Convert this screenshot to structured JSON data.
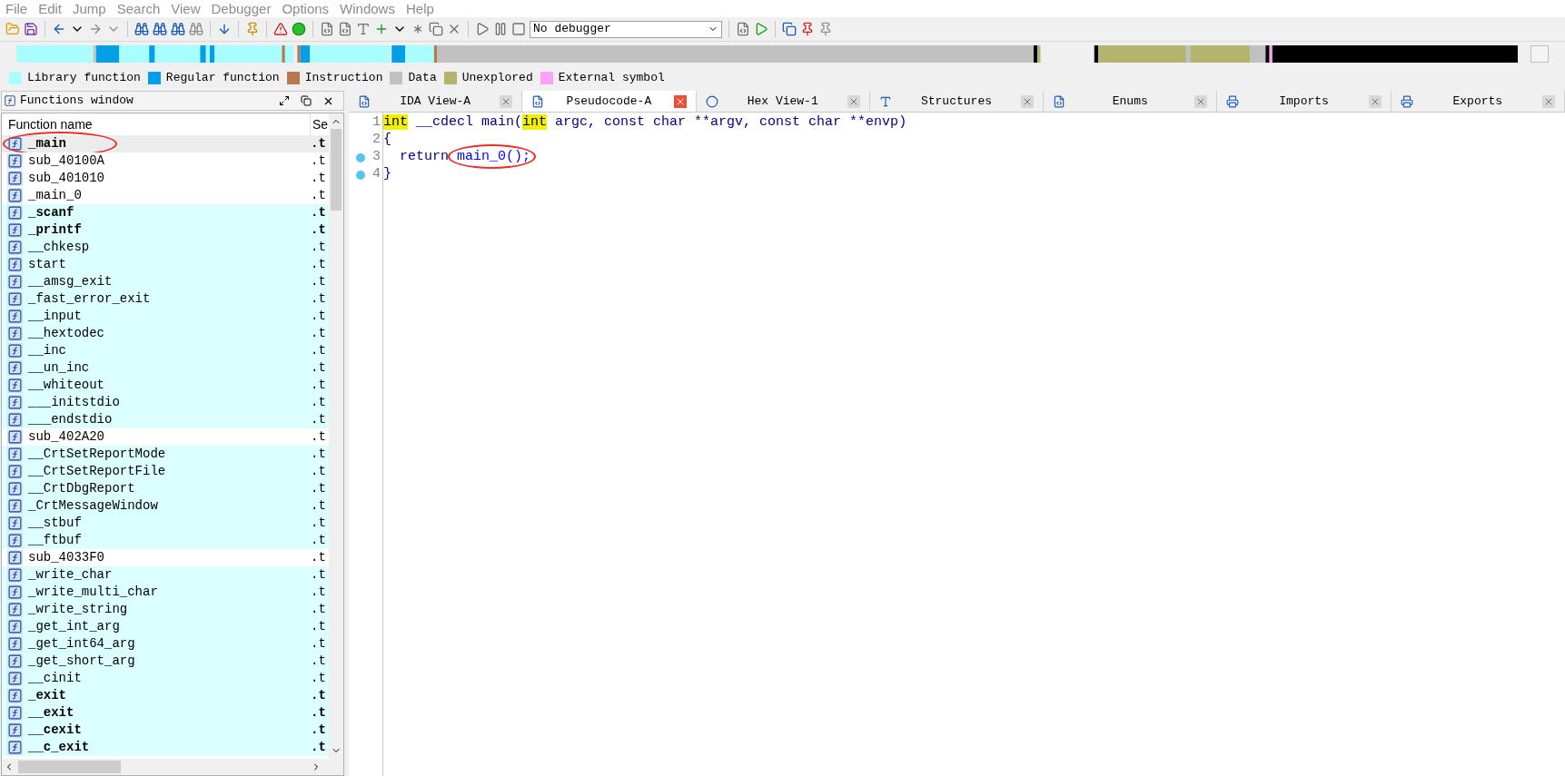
{
  "menu": [
    "File",
    "Edit",
    "Jump",
    "Search",
    "View",
    "Debugger",
    "Options",
    "Windows",
    "Help"
  ],
  "toolbar": {
    "debugger_select": "No debugger"
  },
  "legend": [
    {
      "label": "Library function",
      "color": "#a9ffff"
    },
    {
      "label": "Regular function",
      "color": "#00a0e8"
    },
    {
      "label": "Instruction",
      "color": "#b87850"
    },
    {
      "label": "Data",
      "color": "#c0c0c0"
    },
    {
      "label": "Unexplored",
      "color": "#b4b46c"
    },
    {
      "label": "External symbol",
      "color": "#ffa0f8"
    }
  ],
  "functions_window": {
    "title": "Functions window",
    "columns": [
      "Function name",
      "Se"
    ],
    "rows": [
      {
        "name": "_main",
        "segment": ".t",
        "bold": true,
        "kind": "regular",
        "selected": true,
        "circled": true
      },
      {
        "name": "sub_40100A",
        "segment": ".t",
        "bold": false,
        "kind": "regular",
        "selected": false,
        "circled": false
      },
      {
        "name": "sub_401010",
        "segment": ".t",
        "bold": false,
        "kind": "regular",
        "selected": false,
        "circled": false
      },
      {
        "name": "_main_0",
        "segment": ".t",
        "bold": false,
        "kind": "regular",
        "selected": false,
        "circled": false
      },
      {
        "name": "_scanf",
        "segment": ".t",
        "bold": true,
        "kind": "library",
        "selected": false,
        "circled": false
      },
      {
        "name": "_printf",
        "segment": ".t",
        "bold": true,
        "kind": "library",
        "selected": false,
        "circled": false
      },
      {
        "name": "__chkesp",
        "segment": ".t",
        "bold": false,
        "kind": "library",
        "selected": false,
        "circled": false
      },
      {
        "name": "start",
        "segment": ".t",
        "bold": false,
        "kind": "library",
        "selected": false,
        "circled": false
      },
      {
        "name": "__amsg_exit",
        "segment": ".t",
        "bold": false,
        "kind": "library",
        "selected": false,
        "circled": false
      },
      {
        "name": "_fast_error_exit",
        "segment": ".t",
        "bold": false,
        "kind": "library",
        "selected": false,
        "circled": false
      },
      {
        "name": "__input",
        "segment": ".t",
        "bold": false,
        "kind": "library",
        "selected": false,
        "circled": false
      },
      {
        "name": "__hextodec",
        "segment": ".t",
        "bold": false,
        "kind": "library",
        "selected": false,
        "circled": false
      },
      {
        "name": "__inc",
        "segment": ".t",
        "bold": false,
        "kind": "library",
        "selected": false,
        "circled": false
      },
      {
        "name": "__un_inc",
        "segment": ".t",
        "bold": false,
        "kind": "library",
        "selected": false,
        "circled": false
      },
      {
        "name": "__whiteout",
        "segment": ".t",
        "bold": false,
        "kind": "library",
        "selected": false,
        "circled": false
      },
      {
        "name": "___initstdio",
        "segment": ".t",
        "bold": false,
        "kind": "library",
        "selected": false,
        "circled": false
      },
      {
        "name": "___endstdio",
        "segment": ".t",
        "bold": false,
        "kind": "library",
        "selected": false,
        "circled": false
      },
      {
        "name": "sub_402A20",
        "segment": ".t",
        "bold": false,
        "kind": "regular",
        "selected": false,
        "circled": false
      },
      {
        "name": "__CrtSetReportMode",
        "segment": ".t",
        "bold": false,
        "kind": "library",
        "selected": false,
        "circled": false
      },
      {
        "name": "__CrtSetReportFile",
        "segment": ".t",
        "bold": false,
        "kind": "library",
        "selected": false,
        "circled": false
      },
      {
        "name": "__CrtDbgReport",
        "segment": ".t",
        "bold": false,
        "kind": "library",
        "selected": false,
        "circled": false
      },
      {
        "name": "_CrtMessageWindow",
        "segment": ".t",
        "bold": false,
        "kind": "library",
        "selected": false,
        "circled": false
      },
      {
        "name": "__stbuf",
        "segment": ".t",
        "bold": false,
        "kind": "library",
        "selected": false,
        "circled": false
      },
      {
        "name": "__ftbuf",
        "segment": ".t",
        "bold": false,
        "kind": "library",
        "selected": false,
        "circled": false
      },
      {
        "name": "sub_4033F0",
        "segment": ".t",
        "bold": false,
        "kind": "regular",
        "selected": false,
        "circled": false
      },
      {
        "name": "_write_char",
        "segment": ".t",
        "bold": false,
        "kind": "library",
        "selected": false,
        "circled": false
      },
      {
        "name": "_write_multi_char",
        "segment": ".t",
        "bold": false,
        "kind": "library",
        "selected": false,
        "circled": false
      },
      {
        "name": "_write_string",
        "segment": ".t",
        "bold": false,
        "kind": "library",
        "selected": false,
        "circled": false
      },
      {
        "name": "_get_int_arg",
        "segment": ".t",
        "bold": false,
        "kind": "library",
        "selected": false,
        "circled": false
      },
      {
        "name": "_get_int64_arg",
        "segment": ".t",
        "bold": false,
        "kind": "library",
        "selected": false,
        "circled": false
      },
      {
        "name": "_get_short_arg",
        "segment": ".t",
        "bold": false,
        "kind": "library",
        "selected": false,
        "circled": false
      },
      {
        "name": "__cinit",
        "segment": ".t",
        "bold": false,
        "kind": "library",
        "selected": false,
        "circled": false
      },
      {
        "name": "_exit",
        "segment": ".t",
        "bold": true,
        "kind": "library",
        "selected": false,
        "circled": false
      },
      {
        "name": "__exit",
        "segment": ".t",
        "bold": true,
        "kind": "library",
        "selected": false,
        "circled": false
      },
      {
        "name": "__cexit",
        "segment": ".t",
        "bold": true,
        "kind": "library",
        "selected": false,
        "circled": false
      },
      {
        "name": "__c_exit",
        "segment": ".t",
        "bold": true,
        "kind": "library",
        "selected": false,
        "circled": false
      }
    ]
  },
  "tabs": [
    {
      "label": "IDA View-A",
      "selected": false
    },
    {
      "label": "Pseudocode-A",
      "selected": true
    },
    {
      "label": "Hex View-1",
      "selected": false
    },
    {
      "label": "Structures",
      "selected": false
    },
    {
      "label": "Enums",
      "selected": false
    },
    {
      "label": "Imports",
      "selected": false
    },
    {
      "label": "Exports",
      "selected": false
    }
  ],
  "code": [
    {
      "number": "1",
      "marker": false,
      "tokens": [
        {
          "text": "int",
          "kind": "highlight"
        },
        {
          "text": " __cdecl main(",
          "kind": "plain"
        },
        {
          "text": "int",
          "kind": "highlight"
        },
        {
          "text": " argc, const char **argv, const char **envp)",
          "kind": "plain"
        }
      ]
    },
    {
      "number": "2",
      "marker": false,
      "tokens": [
        {
          "text": "{",
          "kind": "plain"
        }
      ]
    },
    {
      "number": "3",
      "marker": true,
      "tokens": [
        {
          "text": "  return ",
          "kind": "plain"
        },
        {
          "text": "main_0();",
          "kind": "call",
          "circled": true
        }
      ]
    },
    {
      "number": "4",
      "marker": true,
      "tokens": [
        {
          "text": "}",
          "kind": "plain"
        }
      ]
    }
  ]
}
